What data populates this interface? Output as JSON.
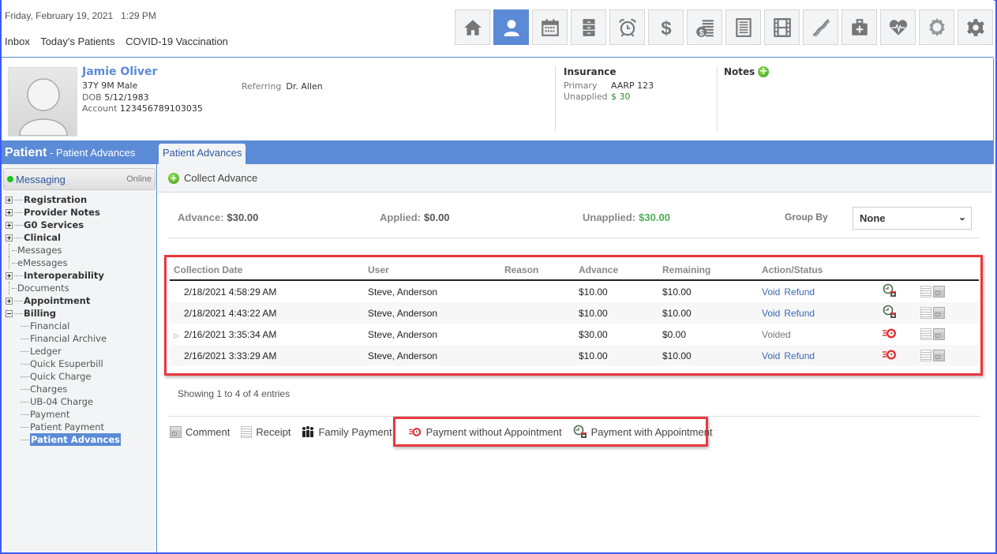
{
  "header": {
    "datetime": "Friday, February 19, 2021   1:29 PM",
    "nav": [
      "Inbox",
      "Today's Patients",
      "COVID-19 Vaccination"
    ],
    "icon_buttons": [
      {
        "name": "home-icon",
        "active": false
      },
      {
        "name": "patient-icon",
        "active": true
      },
      {
        "name": "calendar-icon",
        "active": false
      },
      {
        "name": "filing-cabinet-icon",
        "active": false
      },
      {
        "name": "alarm-clock-icon",
        "active": false
      },
      {
        "name": "dollar-icon",
        "active": false
      },
      {
        "name": "billing-coins-icon",
        "active": false
      },
      {
        "name": "document-list-icon",
        "active": false
      },
      {
        "name": "film-icon",
        "active": false
      },
      {
        "name": "dna-icon",
        "active": false
      },
      {
        "name": "medical-kit-icon",
        "active": false
      },
      {
        "name": "heart-pulse-icon",
        "active": false
      },
      {
        "name": "award-badge-icon",
        "active": false
      },
      {
        "name": "gear-icon",
        "active": false
      }
    ]
  },
  "patient": {
    "name": "Jamie Oliver",
    "age_sex": "37Y 9M Male",
    "dob_label": "DOB",
    "dob": "5/12/1983",
    "account_label": "Account",
    "account": "123456789103035",
    "referring_label": "Referring",
    "referring": "Dr. Allen",
    "insurance_title": "Insurance",
    "primary_label": "Primary",
    "primary": "AARP 123",
    "unapplied_label": "Unapplied",
    "unapplied": "$ 30",
    "notes_label": "Notes"
  },
  "band": {
    "title_bold": "Patient",
    "title_rest": " - Patient Advances",
    "tab": "Patient Advances"
  },
  "sidebar": {
    "messaging": {
      "label": "Messaging",
      "status": "Online"
    },
    "tree": [
      {
        "label": "Registration",
        "type": "expandable"
      },
      {
        "label": "Provider Notes",
        "type": "expandable"
      },
      {
        "label": "G0 Services",
        "type": "expandable"
      },
      {
        "label": "Clinical",
        "type": "expandable"
      },
      {
        "label": "Messages",
        "type": "leaf"
      },
      {
        "label": "eMessages",
        "type": "leaf"
      },
      {
        "label": "Interoperability",
        "type": "expandable"
      },
      {
        "label": "Documents",
        "type": "leaf"
      },
      {
        "label": "Appointment",
        "type": "expandable"
      },
      {
        "label": "Billing",
        "type": "expanded"
      }
    ],
    "billing_children": [
      "Financial",
      "Financial Archive",
      "Ledger",
      "Quick Esuperbill",
      "Quick Charge",
      "Charges",
      "UB-04 Charge",
      "Payment",
      "Patient Payment",
      "Patient Advances"
    ],
    "selected": "Patient Advances"
  },
  "main": {
    "collect_advance": "Collect Advance",
    "summary": {
      "advance_label": "Advance:",
      "advance": "$30.00",
      "applied_label": "Applied:",
      "applied": "$0.00",
      "unapplied_label": "Unapplied:",
      "unapplied": "$30.00",
      "group_by_label": "Group By",
      "group_by_value": "None"
    },
    "table": {
      "columns": [
        "Collection Date",
        "User",
        "Reason",
        "Advance",
        "Remaining",
        "Action/Status"
      ],
      "rows": [
        {
          "date": "2/18/2021 4:58:29 AM",
          "user": "Steve, Anderson",
          "reason": "",
          "advance": "$10.00",
          "remaining": "$10.00",
          "void": "Void",
          "refund": "Refund",
          "status": "",
          "appt_icon": "payment-with-appointment-icon",
          "expandable": false
        },
        {
          "date": "2/18/2021 4:43:22 AM",
          "user": "Steve, Anderson",
          "reason": "",
          "advance": "$10.00",
          "remaining": "$10.00",
          "void": "Void",
          "refund": "Refund",
          "status": "",
          "appt_icon": "payment-with-appointment-icon",
          "expandable": false
        },
        {
          "date": "2/16/2021 3:35:34 AM",
          "user": "Steve, Anderson",
          "reason": "",
          "advance": "$30.00",
          "remaining": "$0.00",
          "void": "",
          "refund": "",
          "status": "Voided",
          "appt_icon": "payment-without-appointment-icon",
          "expandable": true
        },
        {
          "date": "2/16/2021 3:33:29 AM",
          "user": "Steve, Anderson",
          "reason": "",
          "advance": "$10.00",
          "remaining": "$10.00",
          "void": "Void",
          "refund": "Refund",
          "status": "",
          "appt_icon": "payment-without-appointment-icon",
          "expandable": false
        }
      ]
    },
    "showing": "Showing 1 to 4 of 4 entries",
    "footer": {
      "comment": "Comment",
      "receipt": "Receipt",
      "family_payment": "Family Payment",
      "payment_without_appt": "Payment without Appointment",
      "payment_with_appt": "Payment with Appointment"
    }
  },
  "colors": {
    "accent": "#5b8bd6",
    "highlight": "#e8383d",
    "green": "#4caf50",
    "link": "#3a6ab0"
  }
}
